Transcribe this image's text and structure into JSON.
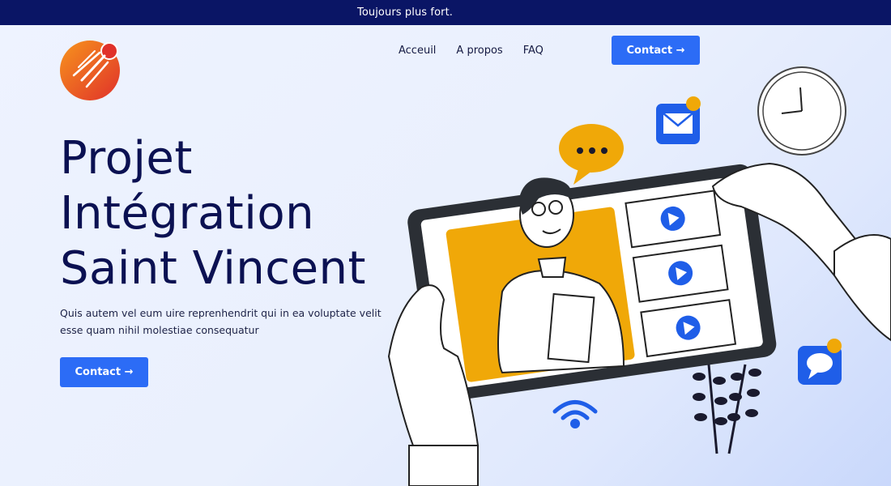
{
  "topbar": {
    "tagline": "Toujours plus fort."
  },
  "brand": {
    "logo_icon": "rocket-ball-icon",
    "colors": {
      "orange": "#f7941d",
      "red": "#e0312a"
    }
  },
  "nav": {
    "items": [
      {
        "label": "Acceuil"
      },
      {
        "label": "A propos"
      },
      {
        "label": "FAQ"
      }
    ],
    "cta_label": "Contact →"
  },
  "hero": {
    "title_lines": [
      "Projet",
      "Intégration",
      "Saint Vincent"
    ],
    "description": "Quis autem vel eum uire reprenhendrit qui in ea voluptate velit esse quam nihil molestiae consequatur",
    "cta_label": "Contact →"
  },
  "theme": {
    "accent": "#2c6cf6",
    "dark_navy": "#0a1565",
    "yellow": "#f0a808"
  },
  "illustration": {
    "icons": [
      "tablet-icon",
      "video-call-icon",
      "play-icon",
      "chat-bubble-icon",
      "mail-icon",
      "clock-icon",
      "wifi-icon",
      "plant-icon",
      "message-icon"
    ]
  }
}
